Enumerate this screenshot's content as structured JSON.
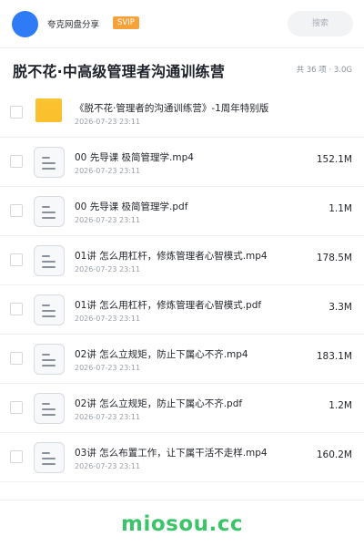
{
  "header": {
    "app_name": "夸克网盘分享",
    "badge": "SVIP",
    "search_placeholder": "搜索"
  },
  "folder": {
    "title": "脱不花·中高级管理者沟通训练营",
    "meta": "共 36 项 · 3.0G"
  },
  "files": [
    {
      "type": "folder",
      "name": "《脱不花·管理者的沟通训练营》-1周年特别版",
      "date": "2026-07-23 23:11",
      "size": ""
    },
    {
      "type": "file",
      "name": "00 先导课 极简管理学.mp4",
      "date": "2026-07-23 23:11",
      "size": "152.1M"
    },
    {
      "type": "file",
      "name": "00 先导课 极简管理学.pdf",
      "date": "2026-07-23 23:11",
      "size": "1.1M"
    },
    {
      "type": "file",
      "name": "01讲 怎么用杠杆，修炼管理者心智模式.mp4",
      "date": "2026-07-23 23:11",
      "size": "178.5M"
    },
    {
      "type": "file",
      "name": "01讲 怎么用杠杆，修炼管理者心智模式.pdf",
      "date": "2026-07-23 23:11",
      "size": "3.3M"
    },
    {
      "type": "file",
      "name": "02讲 怎么立规矩，防止下属心不齐.mp4",
      "date": "2026-07-23 23:11",
      "size": "183.1M"
    },
    {
      "type": "file",
      "name": "02讲 怎么立规矩，防止下属心不齐.pdf",
      "date": "2026-07-23 23:11",
      "size": "1.2M"
    },
    {
      "type": "file",
      "name": "03讲 怎么布置工作，让下属干活不走样.mp4",
      "date": "2026-07-23 23:11",
      "size": "160.2M"
    }
  ],
  "watermark": "miosou.cc",
  "colors": {
    "avatar": "#2f7bf5",
    "badge": "#f7a13b",
    "folder": "#fbc02d",
    "watermark": "#3cc46a"
  }
}
